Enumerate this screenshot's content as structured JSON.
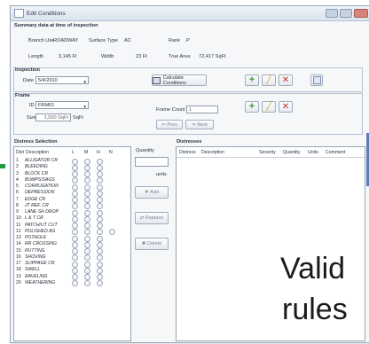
{
  "window": {
    "title": "Edit Conditions"
  },
  "summary": {
    "heading": "Summary data at time of inspection",
    "branch_use_label": "Branch Use",
    "branch_use_value": "ROADWAY",
    "surface_type_label": "Surface Type",
    "surface_type_value": "AC",
    "rank_label": "Rank",
    "rank_value": "P",
    "length_label": "Length",
    "length_value": "3,145 Ft",
    "width_label": "Width",
    "width_value": "23 Ft",
    "true_area_label": "True Area",
    "true_area_value": "72,417 SqFt"
  },
  "inspection": {
    "heading": "Inspection",
    "date_label": "Date",
    "date_value": "5/4/2010",
    "calculate_button": "Calculate Conditions"
  },
  "frame": {
    "heading": "Frame",
    "id_label": "ID",
    "id_value": "FRM01",
    "size_label": "Size",
    "size_value": "1,500 SqFt",
    "frame_count_label": "Frame Count",
    "frame_count_value": "1",
    "prev_button": "Prev",
    "next_button": "Next"
  },
  "distress_selection": {
    "heading": "Distress Selection",
    "columns": [
      "Dist",
      "Description",
      "L",
      "M",
      "H",
      "N"
    ],
    "quantity_label": "Quantity",
    "units_label": "units",
    "add_button": "Add",
    "replace_button": "Replace",
    "delete_button": "Delete",
    "rows": [
      {
        "n": "1",
        "d": "ALLIGATOR CR"
      },
      {
        "n": "2",
        "d": "BLEEDING"
      },
      {
        "n": "3",
        "d": "BLOCK CR"
      },
      {
        "n": "4",
        "d": "BUMPS/SAGS"
      },
      {
        "n": "5",
        "d": "CORRUGATION"
      },
      {
        "n": "6",
        "d": "DEPRESSION"
      },
      {
        "n": "7",
        "d": "EDGE CR"
      },
      {
        "n": "8",
        "d": "JT REF. CR"
      },
      {
        "n": "9",
        "d": "LANE SH DROP"
      },
      {
        "n": "10",
        "d": "L & T CR"
      },
      {
        "n": "11",
        "d": "PATCH/UT CUT"
      },
      {
        "n": "12",
        "d": "POLISHED AG"
      },
      {
        "n": "13",
        "d": "POTHOLE"
      },
      {
        "n": "14",
        "d": "RR CROSSING"
      },
      {
        "n": "15",
        "d": "RUTTING"
      },
      {
        "n": "16",
        "d": "SHOVING"
      },
      {
        "n": "17",
        "d": "SLIPPAGE CR"
      },
      {
        "n": "18",
        "d": "SWELL"
      },
      {
        "n": "19",
        "d": "RAVELING"
      },
      {
        "n": "20",
        "d": "WEATHERING"
      }
    ]
  },
  "distresses": {
    "heading": "Distresses",
    "columns": [
      "Distress",
      "Description",
      "Severity",
      "Quantity",
      "Units",
      "Comment"
    ]
  },
  "overlay": {
    "line1": "Valid",
    "line2": "rules"
  }
}
